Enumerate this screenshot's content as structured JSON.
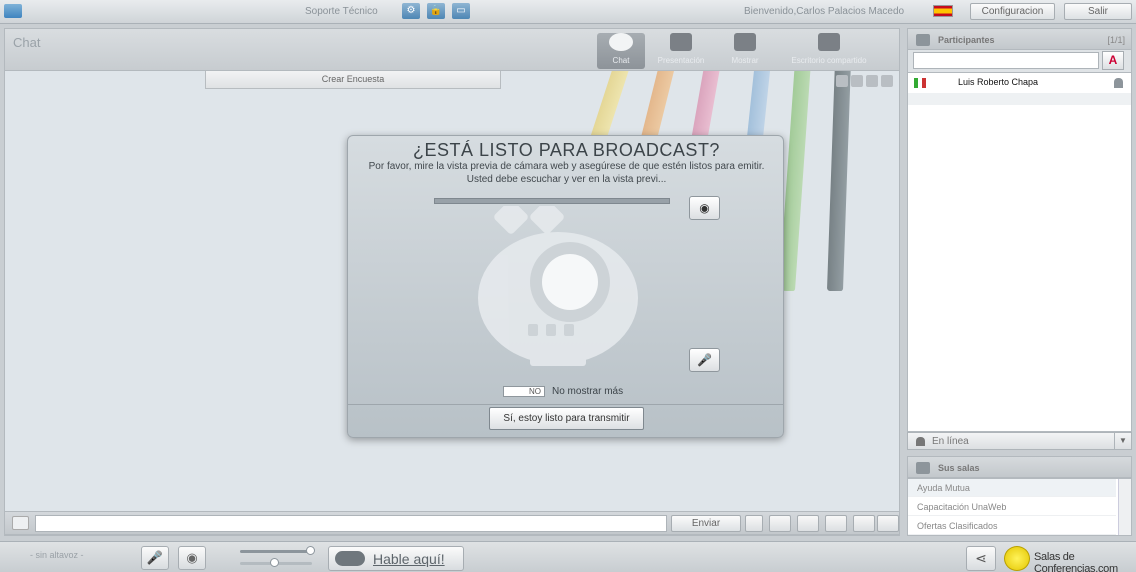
{
  "topbar": {
    "support_label": "Soporte Técnico",
    "welcome": "Bienvenido,Carlos Palacios Macedo",
    "config_button": "Configuracion",
    "exit_button": "Salir"
  },
  "main": {
    "title": "Chat",
    "tabs": [
      {
        "label": "Chat",
        "icon": "chat-bubble-icon",
        "active": true
      },
      {
        "label": "Presentación",
        "icon": "presentation-icon",
        "active": false
      },
      {
        "label": "Mostrar",
        "icon": "video-camera-icon",
        "active": false
      },
      {
        "label": "Escritorio compartido",
        "icon": "monitor-icon",
        "active": false
      }
    ],
    "survey_button": "Crear Encuesta"
  },
  "dialog": {
    "title": "¿ESTÁ LISTO PARA BROADCAST?",
    "message": "Por favor, mire la vista previa de cámara web y asegúrese de que estén listos para emitir. Usted debe escuchar y ver en la vista previ...",
    "toggle_value": "NO",
    "toggle_label": "No mostrar más",
    "ready_button": "Sí, estoy listo para transmitir"
  },
  "chat_input": {
    "send_button": "Enviar"
  },
  "footer": {
    "no_speaker": "- sin altavoz -",
    "talk_button": "Hable aquí!",
    "brand": "Salas de Conferencias.com"
  },
  "participants": {
    "title": "Participantes",
    "count": "[1/1]",
    "font_button": "A",
    "items": [
      {
        "name": "Luis Roberto Chapa"
      }
    ],
    "status": "En línea"
  },
  "rooms": {
    "title": "Sus salas",
    "items": [
      {
        "name": "Ayuda Mutua"
      },
      {
        "name": "Capacitación UnaWeb"
      },
      {
        "name": "Ofertas Clasificados"
      }
    ]
  },
  "colors": {
    "accent": "#4d86b4",
    "panel": "#dfe5ea",
    "dialog": "#c8d0d5"
  }
}
